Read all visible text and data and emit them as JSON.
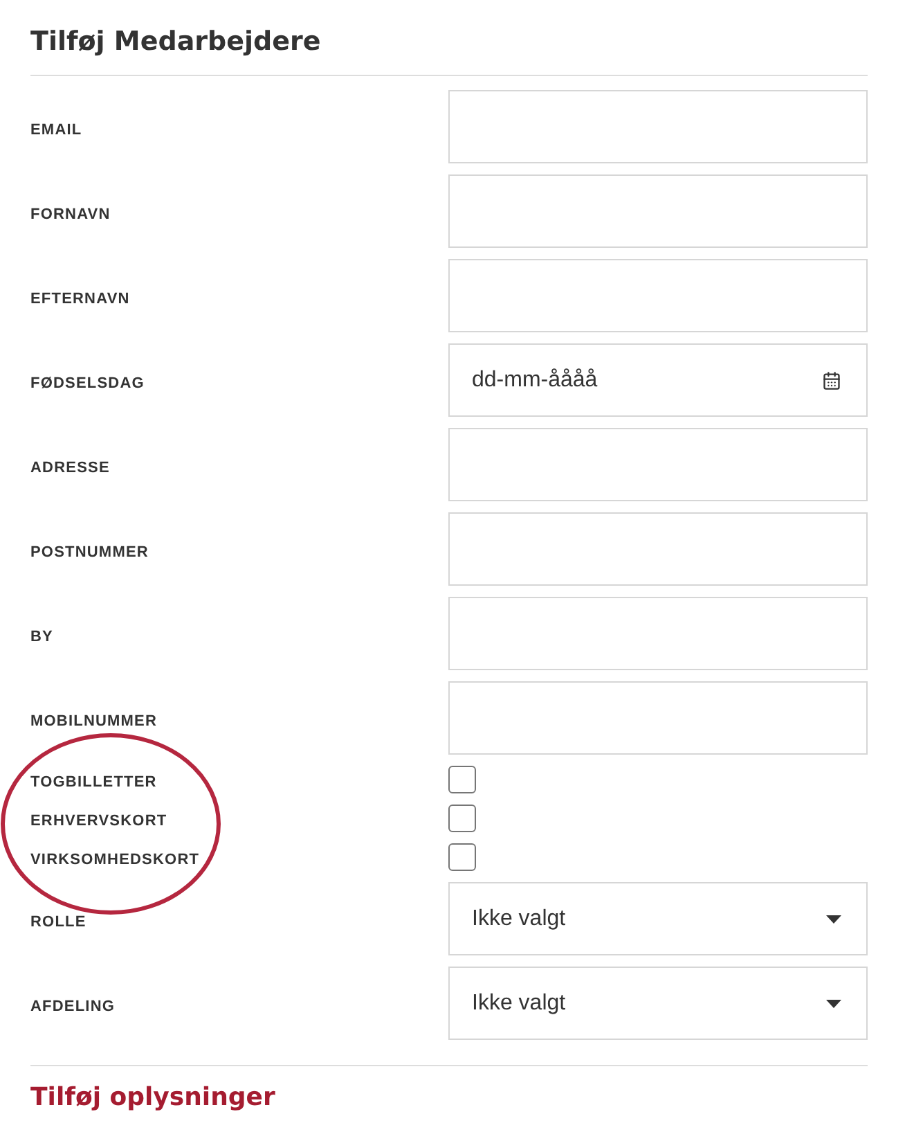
{
  "title": "Tilføj Medarbejdere",
  "fields": [
    {
      "kind": "text",
      "label": "EMAIL"
    },
    {
      "kind": "text",
      "label": "FORNAVN"
    },
    {
      "kind": "text",
      "label": "EFTERNAVN"
    },
    {
      "kind": "date",
      "label": "FØDSELSDAG",
      "placeholder": "dd-mm-åååå"
    },
    {
      "kind": "text",
      "label": "ADRESSE"
    },
    {
      "kind": "text",
      "label": "POSTNUMMER"
    },
    {
      "kind": "text",
      "label": "BY"
    },
    {
      "kind": "text",
      "label": "MOBILNUMMER"
    },
    {
      "kind": "checkbox",
      "label": "TOGBILLETTER",
      "checked": false
    },
    {
      "kind": "checkbox",
      "label": "ERHVERVSKORT",
      "checked": false
    },
    {
      "kind": "checkbox",
      "label": "VIRKSOMHEDSKORT",
      "checked": false
    },
    {
      "kind": "select",
      "label": "ROLLE",
      "value": "Ikke valgt"
    },
    {
      "kind": "select",
      "label": "AFDELING",
      "value": "Ikke valgt"
    }
  ],
  "annotation": {
    "kind": "ellipse"
  },
  "section_title": "Tilføj oplysninger"
}
